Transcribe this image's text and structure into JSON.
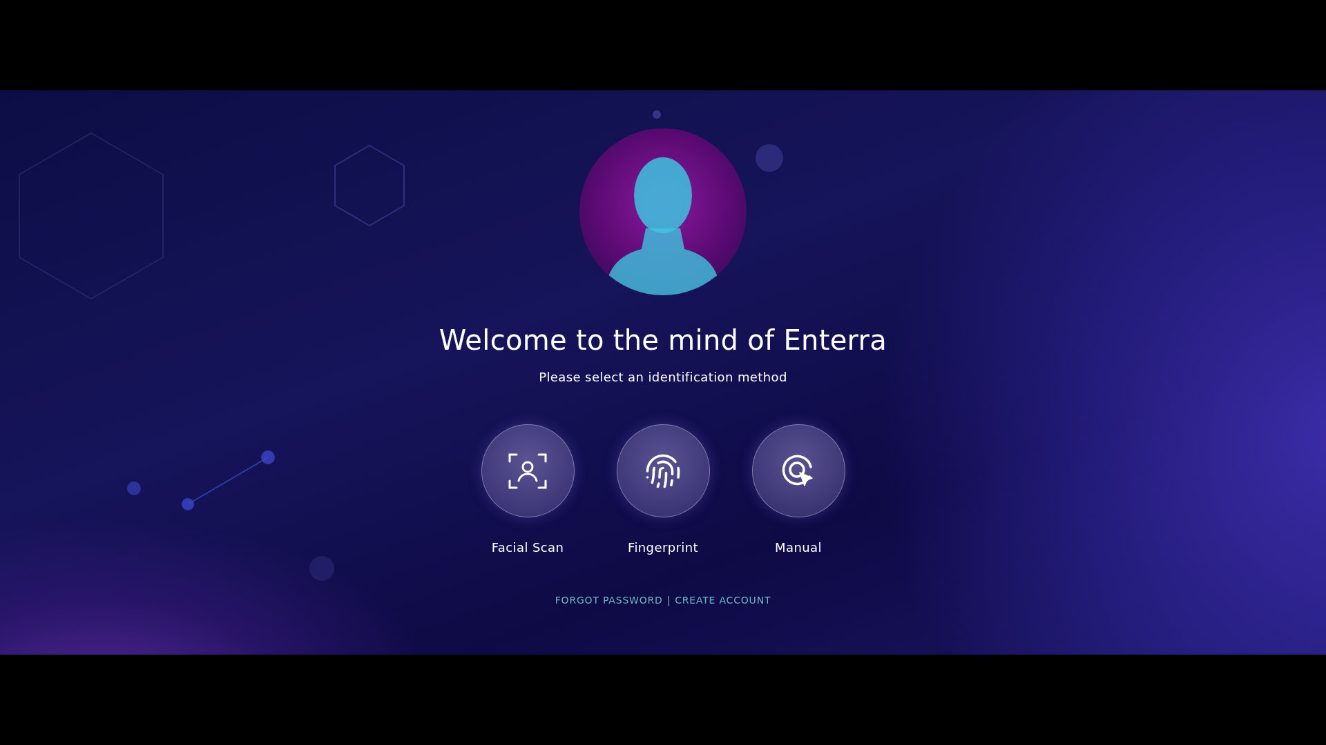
{
  "title": "Welcome to the mind of Enterra",
  "subtitle": "Please select an identification method",
  "methods": [
    {
      "kind": "face",
      "label": "Facial Scan"
    },
    {
      "kind": "fingerprint",
      "label": "Fingerprint"
    },
    {
      "kind": "manual",
      "label": "Manual"
    }
  ],
  "footer": {
    "links": [
      "FORGOT PASSWORD",
      "CREATE ACCOUNT"
    ],
    "separator": "|"
  }
}
